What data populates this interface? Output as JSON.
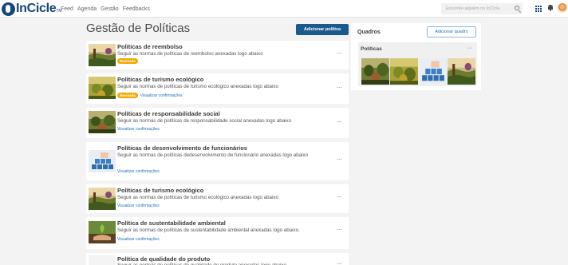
{
  "app": {
    "logo_text": "InCicle",
    "logo_tm": "TM"
  },
  "nav": {
    "items": [
      "Feed",
      "Agenda",
      "Gestão",
      "Feedbacks"
    ]
  },
  "search": {
    "placeholder": "Encontre alguém no InCicle"
  },
  "page": {
    "title": "Gestão de Políticas",
    "add_button": "Adicionar política"
  },
  "policies": [
    {
      "title": "Políticas de reembolso",
      "desc": "Seguir as normas de políticas de reembolso anexadas logo abaixo",
      "badge": "Revisada",
      "link": "",
      "thumb": "vineyard-image"
    },
    {
      "title": "Políticas de turismo ecológico",
      "desc": "Seguir as normas de políticas de turismo ecológico anexadas logo abaixo",
      "badge": "Revisada",
      "link": "Visualizar confirmações",
      "thumb": "grapes-image"
    },
    {
      "title": "Políticas de responsabilidade social",
      "desc": "Seguir as normas de políticas de responsabilidade social anexadas logo abaixo",
      "badge": "",
      "link": "Visualizar confirmações",
      "thumb": "harvest-image"
    },
    {
      "title": "Políticas de desenvolvimento de funcionários",
      "desc": "Seguir as normas de políticas dedesenvolvimento de funcionário anexadas logo abaixo",
      "badge": "",
      "link": "Visualizar confirmações",
      "thumb": "people-blocks-image"
    },
    {
      "title": "Políticas de turismo ecológico",
      "desc": "Seguir as normas de políticas de turismo ecológico anexadas logo abaixo",
      "badge": "",
      "link": "Visualizar confirmações",
      "thumb": "vineyard-image"
    },
    {
      "title": "Política de sustentabilidade ambiental",
      "desc": "Seguir as normas de políticas de sustentabilidade ambiental anexadas logo abaixo.",
      "badge": "",
      "link": "Visualizar confirmações",
      "thumb": "plant-hands-image"
    },
    {
      "title": "Política de qualidade do produto",
      "desc": "Seguir as normas de políticas de qualidade do produto anexadas logo abaixo",
      "badge": "",
      "link": "",
      "thumb": "handshake-image"
    }
  ],
  "panel": {
    "title": "Quadros",
    "add_button": "Adicionar quadro",
    "board": {
      "title": "Políticas",
      "thumbs": [
        "harvest-image",
        "grapes-image",
        "people-blocks-image",
        "vineyard-image"
      ]
    }
  },
  "colors": {
    "brand": "#16477a",
    "primary_button": "#1a5a8c",
    "badge": "#f4a700",
    "link": "#1a6ec2"
  }
}
